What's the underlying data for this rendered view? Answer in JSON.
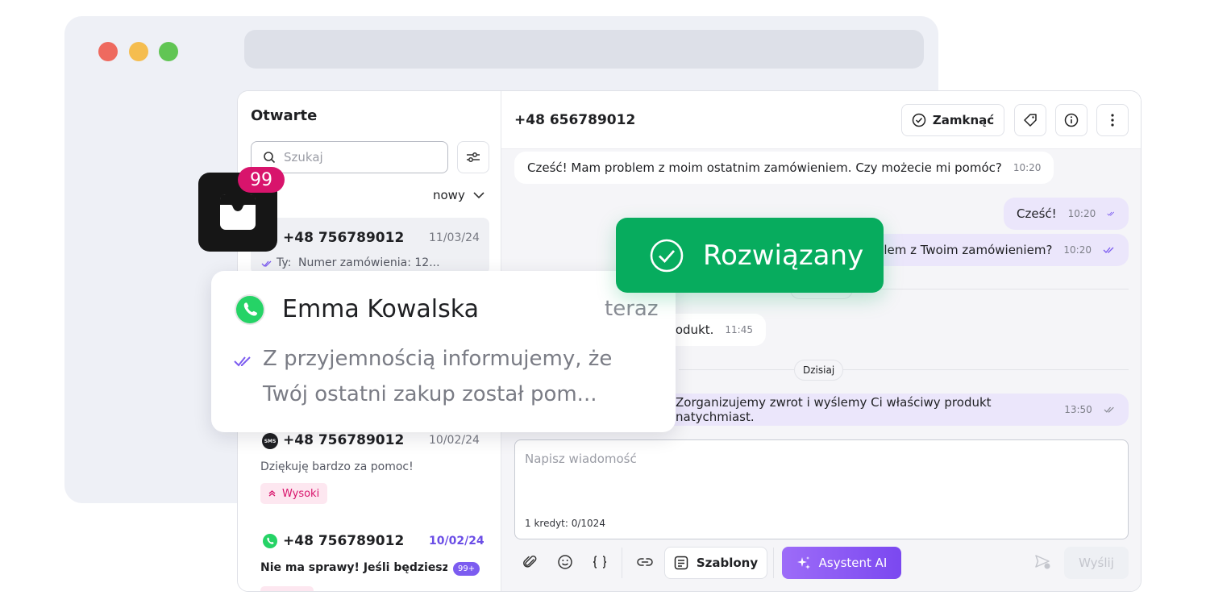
{
  "colors": {
    "accent": "#8b5cf6",
    "resolved": "#07ac5e",
    "badge": "#d8146c",
    "whatsapp": "#25d366"
  },
  "badge_count": "99",
  "sidebar": {
    "title": "Otwarte",
    "search_placeholder": "Szukaj",
    "sort_label": "nowy",
    "items": [
      {
        "channel": "whatsapp",
        "phone": "+48 756789012",
        "date": "11/03/24",
        "prefix": "Ty:",
        "preview": "Numer zamówienia: 12..."
      },
      {
        "channel": "sms",
        "phone": "+48 756789012",
        "date": "10/02/24",
        "preview": "Dziękuję bardzo za pomoc!",
        "tag": "Wysoki"
      },
      {
        "channel": "whatsapp",
        "phone": "+48 756789012",
        "date": "10/02/24",
        "preview": "Nie ma sprawy! Jeśli będziesz...",
        "unread": "99+"
      }
    ]
  },
  "notification": {
    "name": "Emma Kowalska",
    "time": "teraz",
    "message_line1": "Z przyjemnością informujemy, że",
    "message_line2": "Twój ostatni zakup został pom..."
  },
  "chat": {
    "phone": "+48 656789012",
    "close_label": "Zamknąć",
    "messages": [
      {
        "dir": "in",
        "text": "Cześć! Mam problem z moim ostatnim zamówieniem. Czy możecie mi pomóc?",
        "time": "10:20"
      },
      {
        "dir": "out",
        "text": "Cześć!",
        "time": "10:20"
      },
      {
        "dir": "out",
        "text": "blem z Twoim zamówieniem?",
        "time": "10:20"
      },
      {
        "dir": "in",
        "text": "odukt.",
        "time": "11:45"
      },
      {
        "dir": "out",
        "text": "Zorganizujemy zwrot i wyślemy Ci właściwy produkt natychmiast.",
        "time": "13:50"
      }
    ],
    "day_label": "Dzisiaj",
    "input_placeholder": "Napisz wiadomość",
    "credit_label": "1 kredyt: 0/1024",
    "templates_label": "Szablony",
    "ai_label": "Asystent AI",
    "send_label": "Wyślij"
  },
  "status_toast": "Rozwiązany"
}
